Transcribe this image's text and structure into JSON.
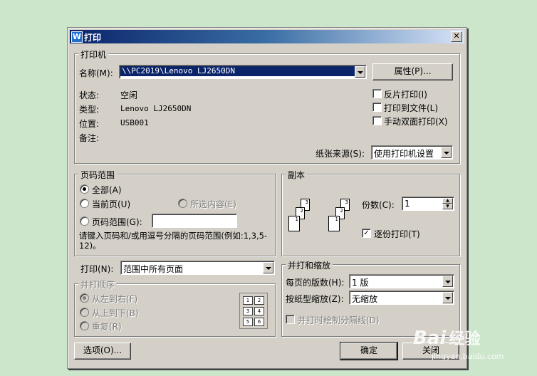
{
  "window": {
    "title": "打印",
    "app_icon": "W"
  },
  "printer": {
    "group_label": "打印机",
    "name_label": "名称(M):",
    "name_value": "\\\\PC2019\\Lenovo LJ2650DN",
    "properties_button": "属性(P)...",
    "status_label": "状态:",
    "status_value": "空闲",
    "type_label": "类型:",
    "type_value": "Lenovo LJ2650DN",
    "location_label": "位置:",
    "location_value": "USB001",
    "comment_label": "备注:",
    "reverse_print": "反片打印(I)",
    "print_to_file": "打印到文件(L)",
    "manual_duplex": "手动双面打印(X)",
    "paper_source_label": "纸张来源(S):",
    "paper_source_value": "使用打印机设置"
  },
  "page_range": {
    "group_label": "页码范围",
    "all": "全部(A)",
    "current_page": "当前页(U)",
    "selection": "所选内容(E)",
    "pages": "页码范围(G):",
    "pages_value": "",
    "hint": "请键入页码和/或用逗号分隔的页码范围(例如:1,3,5-12)。"
  },
  "print_what": {
    "label": "打印(N):",
    "value": "范围中所有页面"
  },
  "order": {
    "group_label": "并打顺序",
    "left_to_right": "从左到右(F)",
    "top_to_bottom": "从上到下(B)",
    "repeat": "重复(R)",
    "grid": [
      "1",
      "2",
      "3",
      "4",
      "5",
      "6"
    ]
  },
  "copies": {
    "group_label": "副本",
    "count_label": "份数(C):",
    "count_value": "1",
    "collate": "逐份打印(T)",
    "stack_pages": [
      "1",
      "2",
      "3"
    ]
  },
  "zoom": {
    "group_label": "并打和缩放",
    "pages_per_sheet_label": "每页的版数(H):",
    "pages_per_sheet_value": "1 版",
    "scale_label": "按纸型缩放(Z):",
    "scale_value": "无缩放",
    "draw_lines": "并打时绘制分隔线(D)"
  },
  "buttons": {
    "options": "选项(O)...",
    "ok": "确定",
    "close": "关闭"
  },
  "watermark": {
    "brand": "Bai",
    "brand_suffix": "经验",
    "url": "jingyan.baidu.com"
  }
}
